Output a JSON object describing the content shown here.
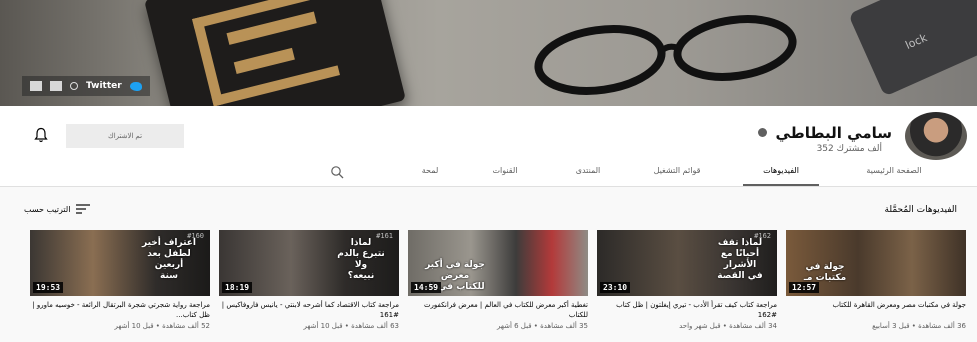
{
  "banner": {
    "twitter_label": "Twitter",
    "laptop_key_label": "lock"
  },
  "channel": {
    "name": "سامي البطاطي",
    "subscribers": "352 ألف مشترك",
    "subscribed_label": "تم الاشتراك"
  },
  "tabs": [
    {
      "label": "الصفحة الرئيسية"
    },
    {
      "label": "الفيديوهات"
    },
    {
      "label": "قوائم التشغيل"
    },
    {
      "label": "المنتدى"
    },
    {
      "label": "القنوات"
    },
    {
      "label": "لمحة"
    }
  ],
  "section": {
    "title": "الفيديوهات المُحمَّلة",
    "sort_label": "الترتيب حسب"
  },
  "videos": [
    {
      "hashtag": "",
      "thumb_text": "جولة في\nمكتبات مـ",
      "duration": "12:57",
      "title": "جولة في مكتبات مصر ومعرض القاهرة للكتاب",
      "meta": "36 ألف مشاهدة • قبل 3 أسابيع"
    },
    {
      "hashtag": "#162",
      "thumb_text": "لماذا تقف\nأحيانًا مع\nالأشرار\nفي القصة",
      "duration": "23:10",
      "title": "مراجعة كتاب كيف تقرأ الأدب - تيري إيغلتون | ظل كتاب #162",
      "meta": "34 ألف مشاهدة • قبل شهر واحد"
    },
    {
      "hashtag": "",
      "thumb_text": "جولة في أكبر معرض\nللكتاب في الـ",
      "duration": "14:59",
      "title": "تغطية أكبر معرض للكتاب في العالم | معرض فرانكفورت للكتاب",
      "meta": "35 ألف مشاهدة • قبل 6 أشهر"
    },
    {
      "hashtag": "#161",
      "thumb_text": "لماذا\nنتبرع بالدم\nولا\nنبيعه؟",
      "duration": "18:19",
      "title": "مراجعة كتاب الاقتصاد كما أشرحه لابنتي - يانيس فاروفاكيس | #161",
      "meta": "63 ألف مشاهدة • قبل 10 أشهر"
    },
    {
      "hashtag": "#160",
      "thumb_text": "اعتراف أخير\nلطفل بعد\nأربعين\nسنة",
      "duration": "19:53",
      "title": "مراجعة رواية شجرتي شجرة البرتقال الرائعة - خوسيه ماورو | ظل كتاب...",
      "meta": "52 ألف مشاهدة • قبل 10 أشهر"
    }
  ],
  "colors": {
    "accent_bird": "#1da1f2",
    "duration_bg": "#000000"
  }
}
